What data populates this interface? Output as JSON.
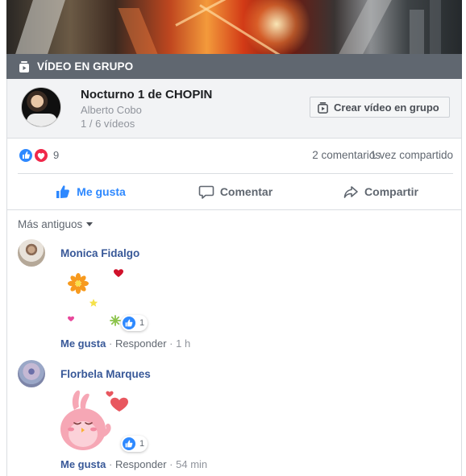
{
  "video_group_bar": {
    "label": "VÍDEO EN GRUPO",
    "icon": "video-playlist-icon"
  },
  "series": {
    "title": "Nocturno 1 de CHOPIN",
    "author": "Alberto Cobo",
    "count": "1 / 6 vídeos",
    "create_button": "Crear vídeo en grupo"
  },
  "reactions": {
    "count": "9",
    "comments": "2 comentarios",
    "shares": "1 vez compartido",
    "icons": [
      "like-icon",
      "love-icon"
    ]
  },
  "actions": {
    "like": "Me gusta",
    "comment": "Comentar",
    "share": "Compartir"
  },
  "sort": {
    "label": "Más antiguos"
  },
  "comments": [
    {
      "author": "Monica Fidalgo",
      "sticker": "flower-sticker",
      "reaction_count": "1",
      "like": "Me gusta",
      "reply": "Responder",
      "sep": "·",
      "time": "1 h"
    },
    {
      "author": "Florbela Marques",
      "sticker": "pink-bird-sticker",
      "reaction_count": "1",
      "like": "Me gusta",
      "reply": "Responder",
      "sep": "·",
      "time": "54 min"
    }
  ],
  "colors": {
    "brand_blue": "#2d88ff",
    "link_blue": "#385898",
    "bar_gray": "#606770",
    "love_red": "#f0284a"
  }
}
